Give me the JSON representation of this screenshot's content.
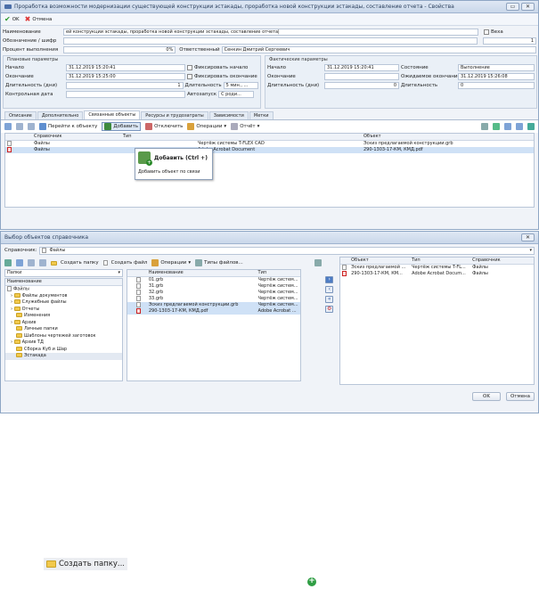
{
  "window1": {
    "title": "Проработка возможности модернизации существующей конструкции эстакады, проработка новой конструкции эстакады, составление отчета - Свойства",
    "toolbar": {
      "ok": "OK",
      "cancel": "Отмена"
    },
    "fields": {
      "name_label": "Наименование",
      "name_value": "ей конструкции эстакады, проработка новой конструкции эстакады, составление отчета|",
      "veha_label": "Веха",
      "code_label": "Обозначение / шифр",
      "code_num": "1",
      "percent_label": "Процент выполнения",
      "percent_value": "0%",
      "responsible_label": "Ответственный",
      "responsible_value": "Сенкин Дмитрий Сергеевич"
    },
    "planned": {
      "title": "Плановые параметры",
      "start_label": "Начало",
      "start_value": "31.12.2019 15:20:41",
      "fix_start": "Фиксировать начало",
      "end_label": "Окончание",
      "end_value": "31.12.2019 15:25:00",
      "fix_end": "Фиксировать окончание",
      "dur_label": "Длительность (дни)",
      "dur_value": "1",
      "dur2_label": "Длительность",
      "dur2_value": "5 мин., ...",
      "control_label": "Контрольная дата",
      "autostart_label": "Автозапуск",
      "autostart_value": "С роди..."
    },
    "actual": {
      "title": "Фактические параметры",
      "start_label": "Начало",
      "start_value": "31.12.2019 15:20:41",
      "state_label": "Состояние",
      "state_value": "Выполнение",
      "end_label": "Окончание",
      "expected_label": "Ожидаемое окончание",
      "expected_value": "31.12.2019 15:26:08",
      "dur_label": "Длительность (дни)",
      "dur_value": "0",
      "dur2_label": "Длительность",
      "dur2_value": "0"
    },
    "tabs": [
      "Описание",
      "Дополнительно",
      "Связанные объекты",
      "Ресурсы и трудозатраты",
      "Зависимости",
      "Метки"
    ],
    "subtoolbar": {
      "goto": "Перейти к объекту",
      "add": "Добавить",
      "disconnect": "Отключить",
      "ops": "Операции",
      "report": "Отчёт"
    },
    "grid": {
      "headers": [
        "Справочник",
        "Тип",
        "Объект"
      ],
      "rows": [
        {
          "ref": "Файлы",
          "type": "Чертёж системы T-FLEX CAD",
          "obj": "Эскиз предлагаемой конструкции.grb"
        },
        {
          "ref": "Файлы",
          "type": "Adobe Acrobat Document",
          "obj": "290-1303-17-КМ, КМД.pdf"
        }
      ]
    },
    "tooltip": {
      "title": "Добавить (Ctrl +)",
      "text": "Добавить объект по связи"
    }
  },
  "window2": {
    "title": "Выбор объектов справочника",
    "ref_label": "Справочник:",
    "ref_value": "Файлы",
    "toolbar": {
      "create_folder": "Создать папку",
      "create_file": "Создать файл",
      "ops": "Операции",
      "types": "Типы файлов..."
    },
    "folders_label": "Папки",
    "tree_header": "Наименование",
    "tree": [
      "Файлы",
      "Файлы документов",
      "Служебные файлы",
      "Отчеты",
      "Изменения",
      "Архив",
      "Личные папки",
      "Шаблоны чертежей заготовок",
      "Архив ТД",
      "Сборка Куб и Шар",
      "Эстакада"
    ],
    "files_headers": [
      "Наименование",
      "Тип"
    ],
    "files": [
      {
        "name": "01.grb",
        "type": "Чертёж систем..."
      },
      {
        "name": "31.grb",
        "type": "Чертёж систем..."
      },
      {
        "name": "32.grb",
        "type": "Чертёж систем..."
      },
      {
        "name": "33.grb",
        "type": "Чертёж систем..."
      },
      {
        "name": "Эскиз предлагаемой конструкции.grb",
        "type": "Чертёж систем..."
      },
      {
        "name": "290-1303-17-КМ, КМД.pdf",
        "type": "Adobe Acrobat ..."
      }
    ],
    "sel_headers": [
      "Объект",
      "Тип",
      "Справочник"
    ],
    "selected": [
      {
        "obj": "Эскиз предлагаемой ...",
        "type": "Чертёж системы T-FL...",
        "ref": "Файлы"
      },
      {
        "obj": "290-1303-17-КМ, КМ...",
        "type": "Adobe Acrobat Docum...",
        "ref": "Файлы"
      }
    ],
    "ok": "OK",
    "cancel": "Отмена"
  },
  "zoom": {
    "create_folder": "Создать папку..."
  }
}
